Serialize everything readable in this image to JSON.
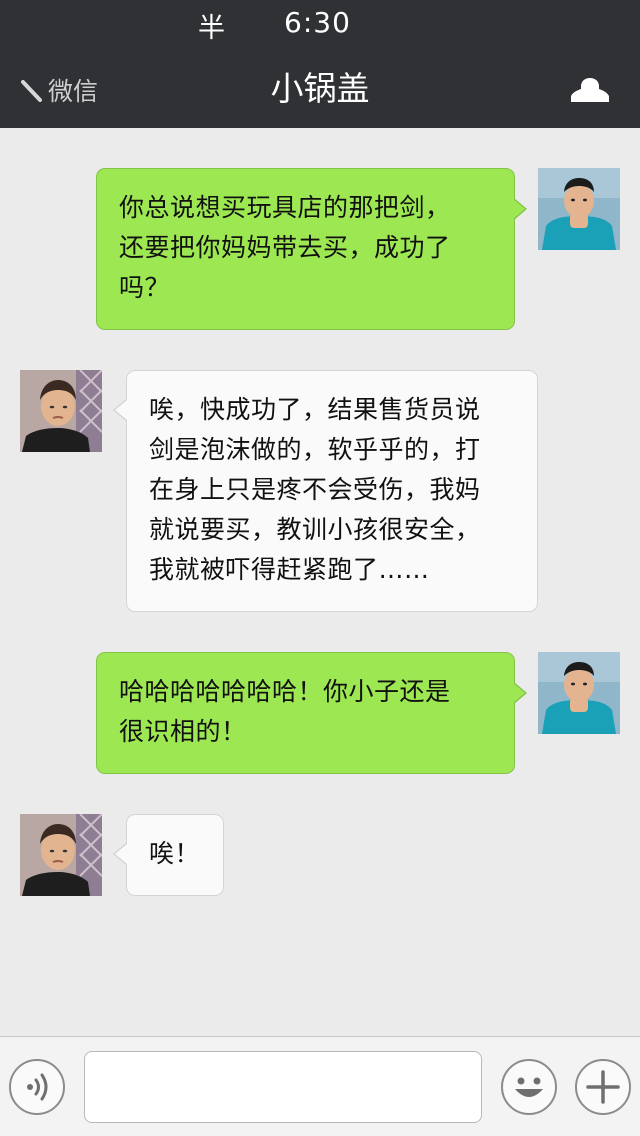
{
  "status_bar": {
    "signal": "半",
    "time": "6:30"
  },
  "nav": {
    "back_label": "微信",
    "title": "小锅盖",
    "back_icon": "back-arrow-icon",
    "profile_icon": "person-icon"
  },
  "colors": {
    "nav_bg": "#2f3134",
    "chat_bg": "#ebebeb",
    "my_bubble": "#9de852",
    "their_bubble": "#fafafa"
  },
  "messages": [
    {
      "sender": "me",
      "lines": [
        "你总说想买玩具店的那把剑，",
        "还要把你妈妈带去买，成功了",
        "吗？"
      ]
    },
    {
      "sender": "them",
      "lines": [
        "唉，快成功了，结果售货员说",
        "剑是泡沫做的，软乎乎的，打",
        "在身上只是疼不会受伤，我妈",
        "就说要买，教训小孩很安全，",
        "我就被吓得赶紧跑了……"
      ]
    },
    {
      "sender": "me",
      "lines": [
        "哈哈哈哈哈哈哈！你小子还是",
        "很识相的！"
      ]
    },
    {
      "sender": "them",
      "lines": [
        "唉！"
      ]
    }
  ],
  "input_bar": {
    "value": "",
    "voice_icon": "voice-icon",
    "emoji_icon": "emoji-icon",
    "add_icon": "plus-icon"
  }
}
